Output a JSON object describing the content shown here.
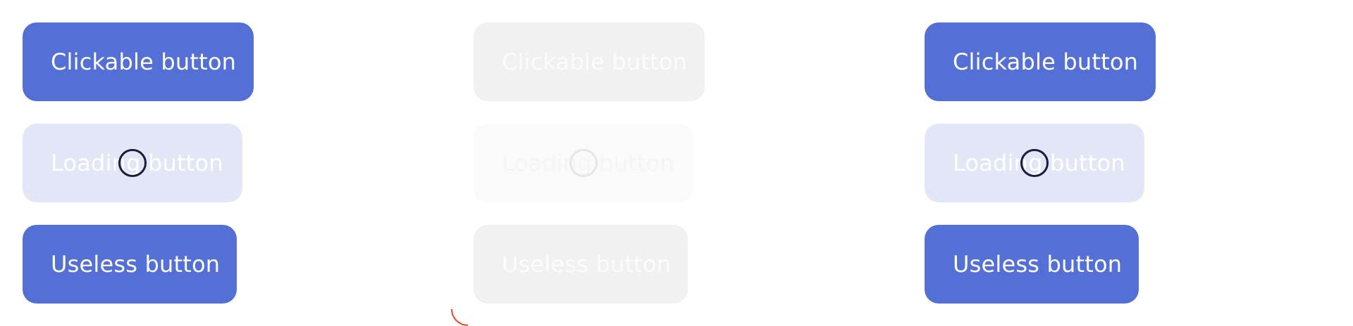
{
  "panels": [
    {
      "state": "enabled",
      "buttons": {
        "clickable": "Clickable button",
        "loading": "Loading button",
        "useless": "Useless button"
      }
    },
    {
      "state": "disabled",
      "buttons": {
        "clickable": "Clickable button",
        "loading": "Loading button",
        "useless": "Useless button"
      }
    },
    {
      "state": "enabled",
      "buttons": {
        "clickable": "Clickable button",
        "loading": "Loading button",
        "useless": "Useless button"
      }
    }
  ],
  "colors": {
    "primary": "#5470d6",
    "loading_bg": "#e3e6f7",
    "disabled_bg": "#f1f1f1",
    "spinner": "#1a1d3a",
    "accent_mark": "#e44b27"
  },
  "icons": {
    "spinner": "loading-spinner-icon"
  }
}
